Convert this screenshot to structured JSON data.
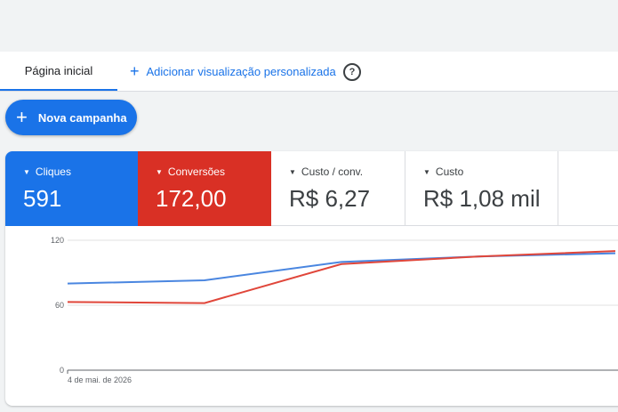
{
  "tabs": {
    "home_label": "Página inicial",
    "add_label": "Adicionar visualização personalizada",
    "help_symbol": "?"
  },
  "new_campaign": {
    "label": "Nova campanha"
  },
  "metrics": [
    {
      "label": "Cliques",
      "value": "591",
      "color": "#1a73e8"
    },
    {
      "label": "Conversões",
      "value": "172,00",
      "color": "#d93025"
    },
    {
      "label": "Custo / conv.",
      "value": "R$ 6,27"
    },
    {
      "label": "Custo",
      "value": "R$ 1,08 mil"
    }
  ],
  "chart_data": {
    "type": "line",
    "x": [
      "4 de mai. de 2026",
      "",
      "",
      "",
      ""
    ],
    "x_tick_labels": [
      "4 de mai. de 2026"
    ],
    "y_ticks": [
      "0",
      "60",
      "120"
    ],
    "ylim": [
      0,
      120
    ],
    "grid": true,
    "series": [
      {
        "color": "#4a86e0",
        "values": [
          80,
          83,
          100,
          105,
          108
        ]
      },
      {
        "color": "#e0463a",
        "values": [
          63,
          62,
          98,
          105,
          110
        ]
      }
    ]
  }
}
